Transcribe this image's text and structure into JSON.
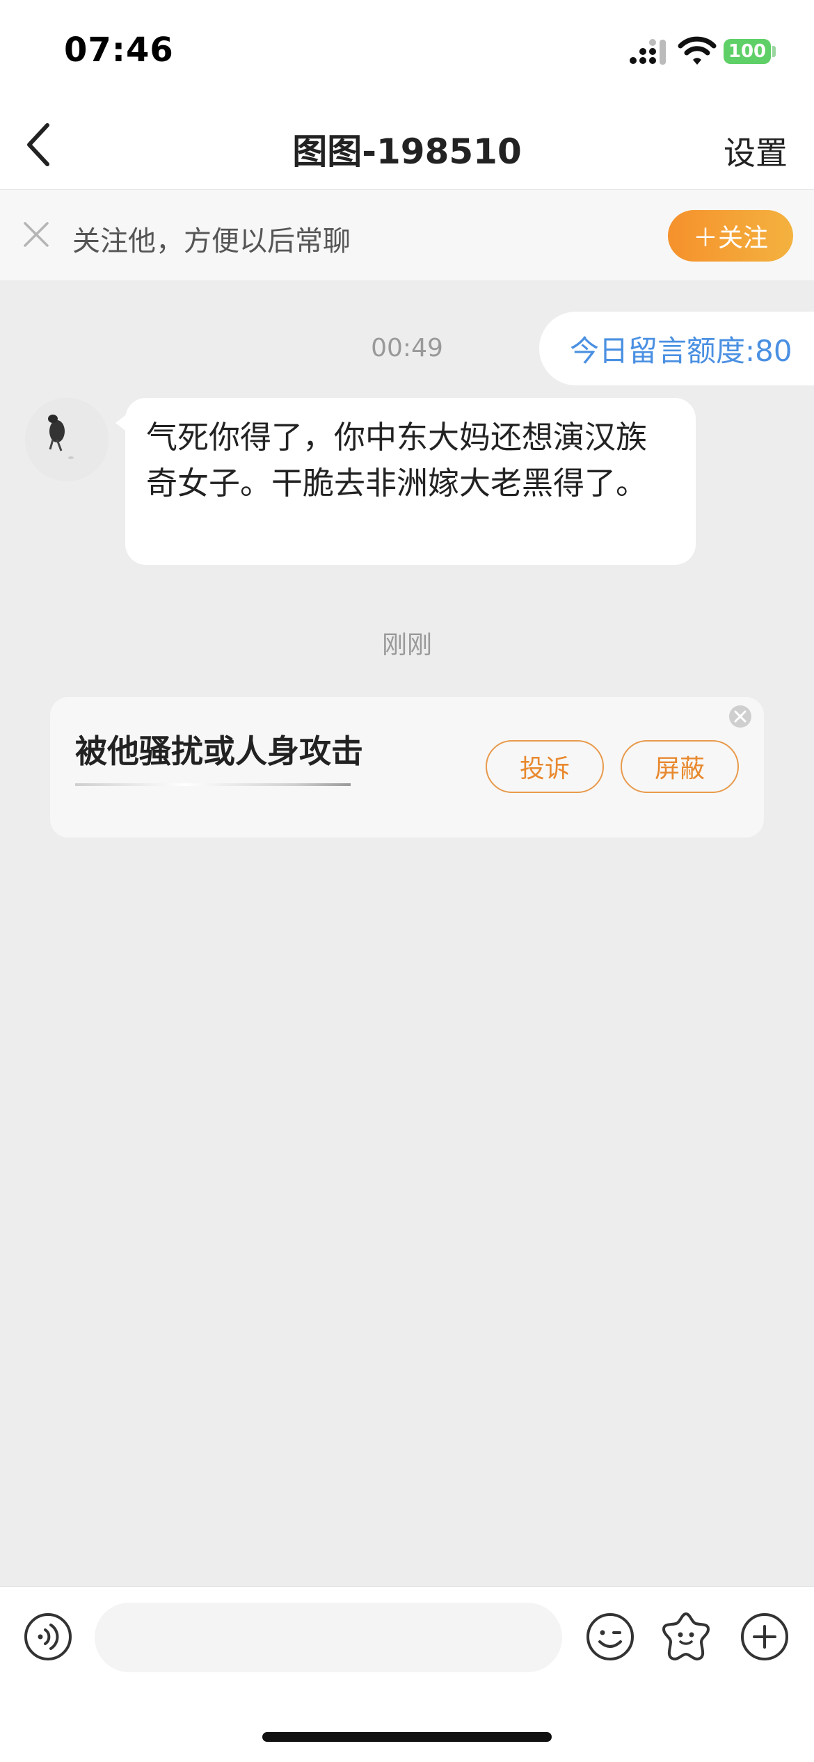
{
  "status_bar": {
    "time": "07:46",
    "battery": "100",
    "icons": [
      "signal-icon",
      "wifi-icon",
      "battery-icon"
    ]
  },
  "nav": {
    "title": "图图-198510",
    "settings_label": "设置",
    "back_icon": "chevron-left-icon"
  },
  "follow_bar": {
    "text": "关注他，方便以后常聊",
    "button_label": "＋关注",
    "close_icon": "close-icon"
  },
  "quota": {
    "text": "今日留言额度:80"
  },
  "messages": [
    {
      "timestamp": "00:49",
      "text": "气死你得了，你中东大妈还想演汉族奇女子。干脆去非洲嫁大老黑得了。"
    }
  ],
  "report_card": {
    "timestamp": "刚刚",
    "title": "被他骚扰或人身攻击",
    "complain_label": "投诉",
    "block_label": "屏蔽"
  },
  "input_bar": {
    "placeholder": "",
    "icons": [
      "voice-icon",
      "emoji-icon",
      "sticker-icon",
      "plus-icon"
    ]
  },
  "colors": {
    "accent_orange": "#f5912c",
    "quota_blue": "#4a90e2",
    "background": "#ededed",
    "battery_green": "#5fd067"
  }
}
